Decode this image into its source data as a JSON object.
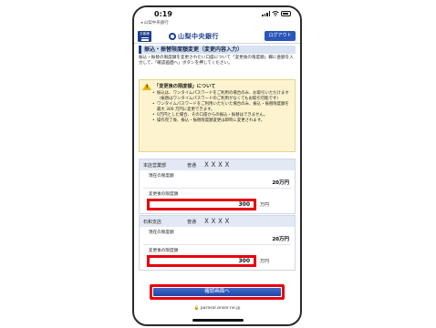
{
  "status_bar": {
    "time": "0:19",
    "back_app": "◂ 山梨中央銀行"
  },
  "header": {
    "menu_label": "お客様",
    "bank_name": "山梨中央銀行",
    "logout_label": "ログアウト"
  },
  "page": {
    "title": "振込・振替限度額変更（変更内容入力）",
    "intro": "振込・振替の限度額を変更されたい口座について「変更後の限度額」欄に金額を入力して、「確認画面へ」ボタンを押してください。"
  },
  "notice": {
    "heading": "「変更後の限度額」について",
    "items": [
      "振込は、ワンタイムパスワードをご利用の場合のみ、お取引いただけます（振替はワンタイムパスワードのご利用がなくてもお取引可能です）",
      "ワンタイムパスワードをご利用いただいた場合のみ、振込・振替限度額を最大 300 万円に変更できます。",
      "0万円とした場合、その口座からの振込・振替はできません。",
      "操作完了後、振込・振替限度額変更は即時に変更されます。"
    ]
  },
  "accounts": [
    {
      "branch": "本店営業部",
      "type": "普通",
      "number": "ＸＸＸＸ",
      "current_label": "現在の限度額",
      "current_value": "20万円",
      "new_label": "変更後の限度額",
      "new_value": "300",
      "unit": "万円"
    },
    {
      "branch": "石和支店",
      "type": "普通",
      "number": "ＸＸＸＸ",
      "current_label": "現在の限度額",
      "current_value": "20万円",
      "new_label": "変更後の限度額",
      "new_value": "300",
      "unit": "万円"
    }
  ],
  "confirm_label": "確認画面へ",
  "url": "🔒 parasol.anser.ne.jp",
  "colors": {
    "brand": "#1f3f8c",
    "highlight": "#e8000b",
    "notice_bg": "#fdf4cf"
  }
}
